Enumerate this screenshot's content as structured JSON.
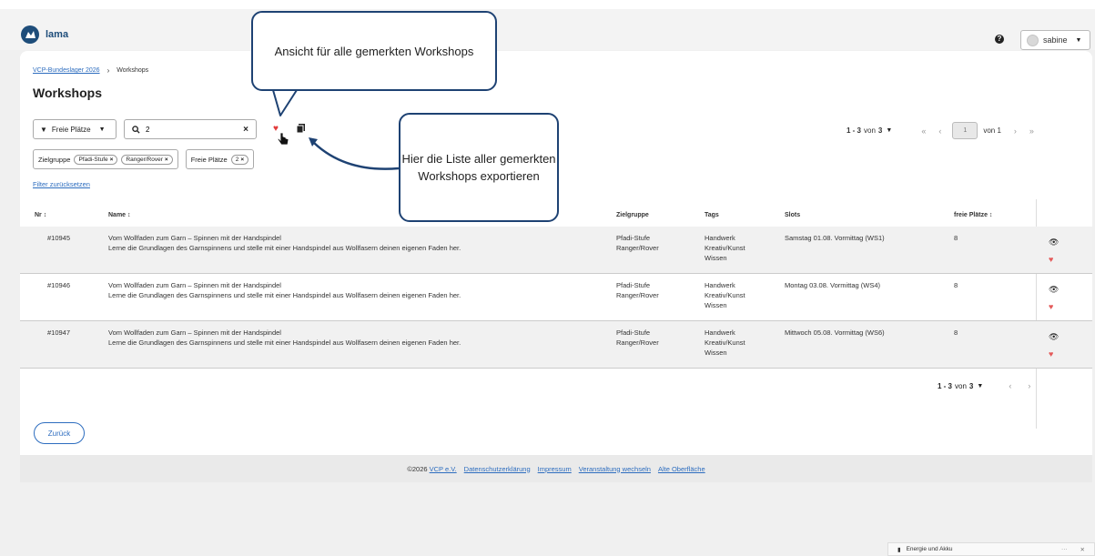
{
  "header": {
    "logo_text": "lama",
    "help_icon": "question-circle-icon",
    "user_name": "sabine"
  },
  "breadcrumb": {
    "event": "VCP-Bundeslager 2026",
    "current": "Workshops"
  },
  "page_title": "Workshops",
  "toolbar": {
    "filter_label": "Freie Plätze",
    "search_value": "2",
    "heart_icon": "heart-icon",
    "export_icon": "copy-icon"
  },
  "chips": {
    "group1_label": "Zielgruppe",
    "group1_chips": [
      "Pfadi-Stufe",
      "Ranger/Rover"
    ],
    "group2_label": "Freie Plätze",
    "group2_chips": [
      "2"
    ],
    "reset": "Filter zurücksetzen"
  },
  "pager": {
    "range": "1 - 3",
    "of_label": "von",
    "total": "3",
    "current_page": "1",
    "page_of": "von 1"
  },
  "table": {
    "headers": {
      "nr": "Nr",
      "name": "Name",
      "zielgruppe": "Zielgruppe",
      "tags": "Tags",
      "slots": "Slots",
      "freie": "freie Plätze"
    },
    "rows": [
      {
        "nr": "#10945",
        "title": "Vom Wollfaden zum Garn – Spinnen mit der Handspindel",
        "desc": "Lerne die Grundlagen des Garnspinnens und stelle mit einer Handspindel aus Wollfasern deinen eigenen Faden her.",
        "ziel1": "Pfadi-Stufe",
        "ziel2": "Ranger/Rover",
        "tag1": "Handwerk",
        "tag2": "Kreativ/Kunst",
        "tag3": "Wissen",
        "slot": "Samstag 01.08. Vormittag (WS1)",
        "freie": "8"
      },
      {
        "nr": "#10946",
        "title": "Vom Wollfaden zum Garn – Spinnen mit der Handspindel",
        "desc": "Lerne die Grundlagen des Garnspinnens und stelle mit einer Handspindel aus Wollfasern deinen eigenen Faden her.",
        "ziel1": "Pfadi-Stufe",
        "ziel2": "Ranger/Rover",
        "tag1": "Handwerk",
        "tag2": "Kreativ/Kunst",
        "tag3": "Wissen",
        "slot": "Montag 03.08. Vormittag (WS4)",
        "freie": "8"
      },
      {
        "nr": "#10947",
        "title": "Vom Wollfaden zum Garn – Spinnen mit der Handspindel",
        "desc": "Lerne die Grundlagen des Garnspinnens und stelle mit einer Handspindel aus Wollfasern deinen eigenen Faden her.",
        "ziel1": "Pfadi-Stufe",
        "ziel2": "Ranger/Rover",
        "tag1": "Handwerk",
        "tag2": "Kreativ/Kunst",
        "tag3": "Wissen",
        "slot": "Mittwoch 05.08. Vormittag (WS6)",
        "freie": "8"
      }
    ]
  },
  "back_label": "Zurück",
  "footer": {
    "copyright": "©2026",
    "org": "VCP e.V.",
    "privacy": "Datenschutzerklärung",
    "imprint": "Impressum",
    "switch_event": "Veranstaltung wechseln",
    "old_ui": "Alte Oberfläche"
  },
  "callouts": {
    "first": "Ansicht für alle gemerkten Workshops",
    "second": "Hier die Liste aller gemerkten Workshops exportieren"
  },
  "toast": {
    "label": "Energie und Akku"
  },
  "colors": {
    "accent": "#2d6dbf",
    "heart": "#e23b3b",
    "callout_border": "#1e4273"
  }
}
